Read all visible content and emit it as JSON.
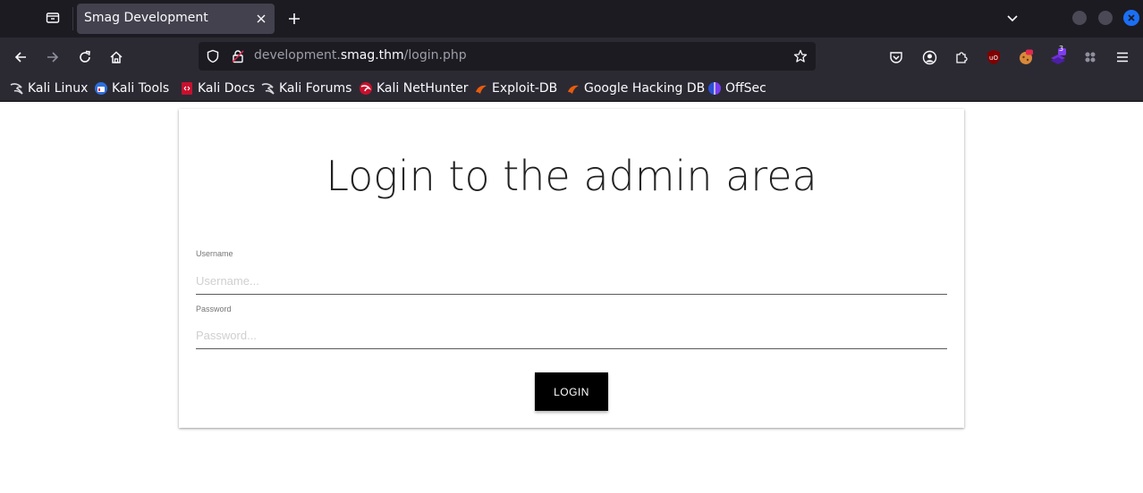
{
  "browser": {
    "tab": {
      "title": "Smag Development"
    },
    "url": {
      "prefix": "development.",
      "host": "smag.thm",
      "path": "/login.php"
    },
    "extensions": {
      "badge_count": "3"
    },
    "bookmarks": [
      {
        "label": "Kali Linux",
        "icon": "kali-dragon-icon"
      },
      {
        "label": "Kali Tools",
        "icon": "kali-tools-icon"
      },
      {
        "label": "Kali Docs",
        "icon": "kali-docs-icon"
      },
      {
        "label": "Kali Forums",
        "icon": "kali-dragon-icon"
      },
      {
        "label": "Kali NetHunter",
        "icon": "nethunter-icon"
      },
      {
        "label": "Exploit-DB",
        "icon": "exploit-db-icon"
      },
      {
        "label": "Google Hacking DB",
        "icon": "exploit-db-icon"
      },
      {
        "label": "OffSec",
        "icon": "offsec-icon"
      }
    ]
  },
  "page": {
    "heading": "Login to the admin area",
    "username": {
      "label": "Username",
      "placeholder": "Username..."
    },
    "password": {
      "label": "Password",
      "placeholder": "Password..."
    },
    "login_button": "LOGIN"
  },
  "colors": {
    "tabbar_bg": "#1c1b22",
    "toolbar_bg": "#2b2a33",
    "accent_close": "#1b6ff5",
    "button_bg": "#000000"
  }
}
